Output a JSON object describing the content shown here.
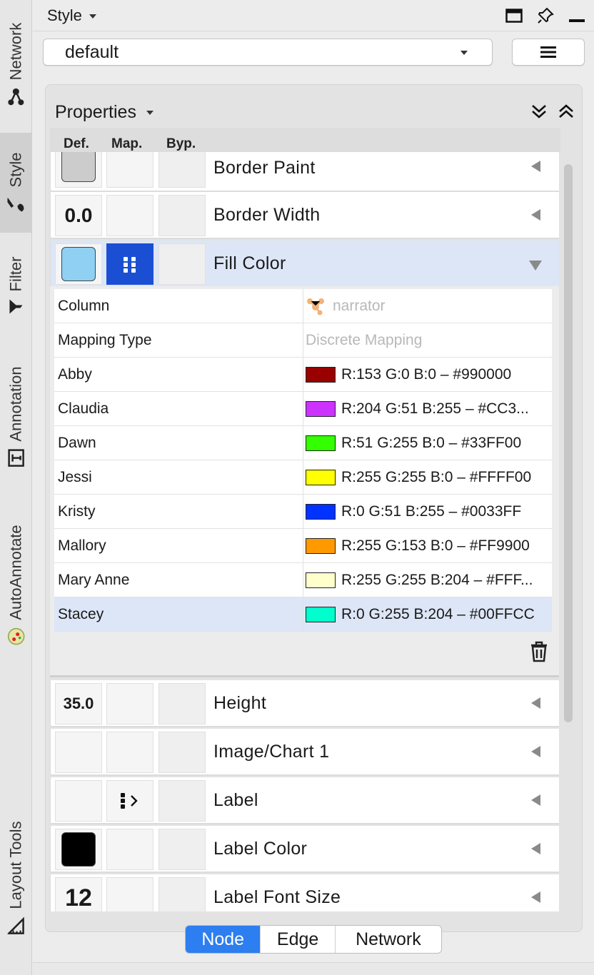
{
  "side_tabs": [
    {
      "label": "Network",
      "icon": "network-icon"
    },
    {
      "label": "Style",
      "icon": "brush-icon"
    },
    {
      "label": "Filter",
      "icon": "filter-icon"
    },
    {
      "label": "Annotation",
      "icon": "text-box-icon"
    },
    {
      "label": "AutoAnnotate",
      "icon": "autoannotate-icon"
    },
    {
      "label": "Layout Tools",
      "icon": "ruler-icon"
    }
  ],
  "header": {
    "title": "Style"
  },
  "style_select": {
    "value": "default"
  },
  "properties": {
    "title": "Properties",
    "columns": {
      "def": "Def.",
      "map": "Map.",
      "byp": "Byp."
    },
    "rows": [
      {
        "name": "Border Paint",
        "def_color": "#cccccc"
      },
      {
        "name": "Border Width",
        "def_value": "0.0"
      },
      {
        "name": "Fill Color",
        "def_color": "#8fd0f3",
        "map_color": "#1a4fd3"
      },
      {
        "name": "Height",
        "def_value": "35.0"
      },
      {
        "name": "Image/Chart 1"
      },
      {
        "name": "Label"
      },
      {
        "name": "Label Color",
        "def_color": "#000000"
      },
      {
        "name": "Label Font Size",
        "def_value": "12"
      }
    ],
    "mapping": {
      "column_label": "Column",
      "column_value": "narrator",
      "type_label": "Mapping Type",
      "type_value": "Discrete Mapping",
      "entries": [
        {
          "key": "Abby",
          "color": "#990000",
          "text": "R:153 G:0 B:0 – #990000"
        },
        {
          "key": "Claudia",
          "color": "#CC33FF",
          "text": "R:204 G:51 B:255 – #CC3..."
        },
        {
          "key": "Dawn",
          "color": "#33FF00",
          "text": "R:51 G:255 B:0 – #33FF00"
        },
        {
          "key": "Jessi",
          "color": "#FFFF00",
          "text": "R:255 G:255 B:0 – #FFFF00"
        },
        {
          "key": "Kristy",
          "color": "#0033FF",
          "text": "R:0 G:51 B:255 – #0033FF"
        },
        {
          "key": "Mallory",
          "color": "#FF9900",
          "text": "R:255 G:153 B:0 – #FF9900"
        },
        {
          "key": "Mary Anne",
          "color": "#FFFFCC",
          "text": "R:255 G:255 B:204 – #FFF..."
        },
        {
          "key": "Stacey",
          "color": "#00FFCC",
          "text": "R:0 G:255 B:204 – #00FFCC"
        }
      ]
    }
  },
  "tabs": [
    {
      "label": "Node",
      "active": true
    },
    {
      "label": "Edge",
      "active": false
    },
    {
      "label": "Network",
      "active": false
    }
  ]
}
